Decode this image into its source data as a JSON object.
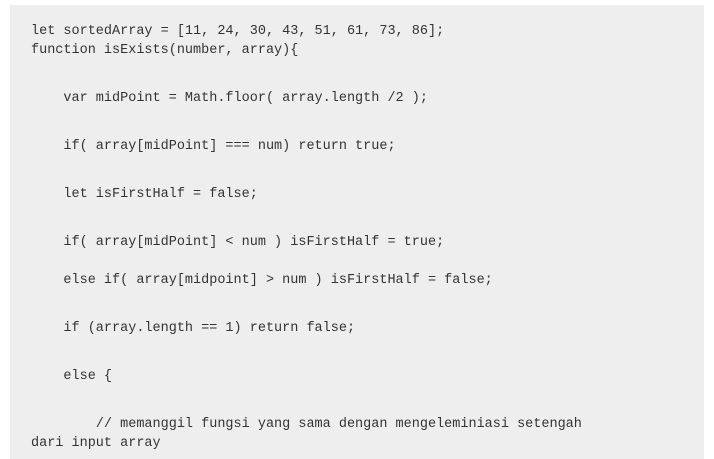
{
  "code": {
    "lines": [
      "let sortedArray = [11, 24, 30, 43, 51, 61, 73, 86];",
      "function isExists(number, array){",
      "    var midPoint = Math.floor( array.length /2 );",
      "    if( array[midPoint] === num) return true;",
      "    let isFirstHalf = false;",
      "    if( array[midPoint] < num ) isFirstHalf = true;",
      "    else if( array[midpoint] > num ) isFirstHalf = false;",
      "    if (array.length == 1) return false;",
      "    else {",
      "        // memanggil fungsi yang sama dengan mengeleminiasi setengah",
      "dari input array"
    ]
  }
}
